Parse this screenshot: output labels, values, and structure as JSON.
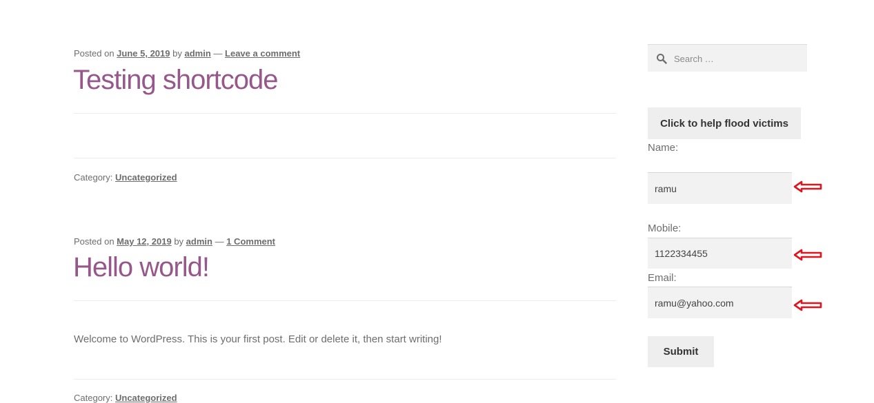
{
  "posts": [
    {
      "posted_on_label": "Posted on",
      "date": "June 5, 2019",
      "by_label": "by",
      "author": "admin",
      "separator": "—",
      "comment_link": "Leave a comment",
      "title": "Testing shortcode",
      "body": "",
      "category_label": "Category:",
      "category": "Uncategorized"
    },
    {
      "posted_on_label": "Posted on",
      "date": "May 12, 2019",
      "by_label": "by",
      "author": "admin",
      "separator": "—",
      "comment_link": "1 Comment",
      "title": "Hello world!",
      "body": "Welcome to WordPress. This is your first post. Edit or delete it, then start writing!",
      "category_label": "Category:",
      "category": "Uncategorized"
    }
  ],
  "sidebar": {
    "search": {
      "placeholder": "Search …",
      "icon": "search-icon"
    },
    "flood_button": "Click to help flood victims",
    "form": {
      "name_label": "Name:",
      "name_value": "ramu",
      "mobile_label": "Mobile:",
      "mobile_value": "1122334455",
      "email_label": "Email:",
      "email_value": "ramu@yahoo.com",
      "submit_label": "Submit"
    }
  },
  "colors": {
    "title": "#96588a",
    "arrow": "#e0141e"
  }
}
